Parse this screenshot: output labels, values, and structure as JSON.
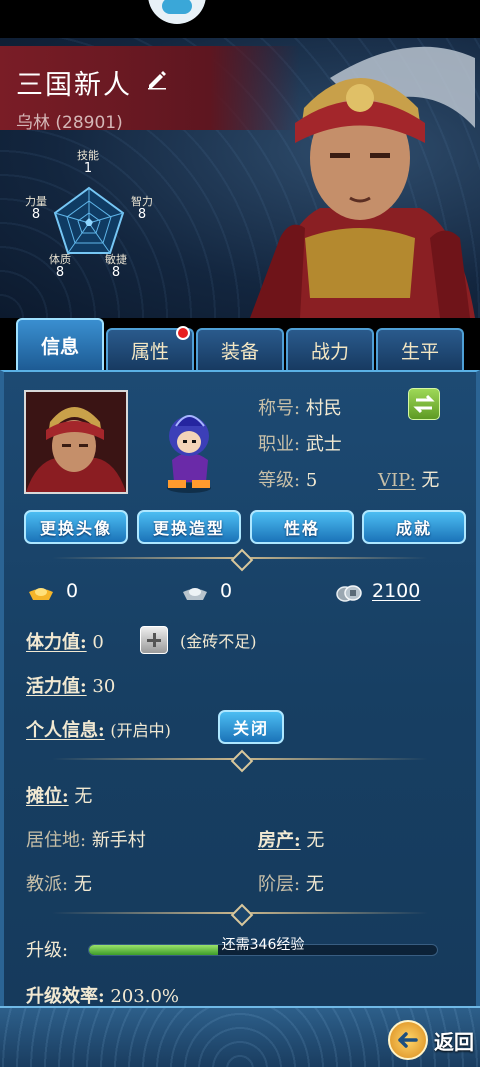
{
  "header": {
    "player_name": "三国新人",
    "player_id": "乌林 (28901)"
  },
  "radar": {
    "skill": {
      "label": "技能",
      "value": "1"
    },
    "wisdom": {
      "label": "智力",
      "value": "8"
    },
    "agility": {
      "label": "敏捷",
      "value": "8"
    },
    "constitution": {
      "label": "体质",
      "value": "8"
    },
    "strength": {
      "label": "力量",
      "value": "8"
    }
  },
  "tabs": [
    {
      "label": "信息",
      "active": true
    },
    {
      "label": "属性",
      "badge": true
    },
    {
      "label": "装备"
    },
    {
      "label": "战力"
    },
    {
      "label": "生平"
    }
  ],
  "profile": {
    "title_label": "称号:",
    "title_value": "村民",
    "job_label": "职业:",
    "job_value": "武士",
    "level_label": "等级:",
    "level_value": "5",
    "vip_label": "VIP:",
    "vip_value": "无"
  },
  "actions": {
    "change_avatar": "更换头像",
    "change_model": "更换造型",
    "personality": "性格",
    "achievements": "成就"
  },
  "resources": {
    "gold": "0",
    "silver": "0",
    "coins": "2100"
  },
  "stats": {
    "stamina_label": "体力值:",
    "stamina_value": "0",
    "stamina_note": "(金砖不足)",
    "vitality_label": "活力值:",
    "vitality_value": "30",
    "privacy_label": "个人信息:",
    "privacy_state": "(开启中)",
    "privacy_button": "关闭"
  },
  "details": {
    "stall_label": "摊位:",
    "stall_value": "无",
    "residence_label": "居住地:",
    "residence_value": "新手村",
    "property_label": "房产:",
    "property_value": "无",
    "sect_label": "教派:",
    "sect_value": "无",
    "rank_label": "阶层:",
    "rank_value": "无"
  },
  "upgrade": {
    "label": "升级:",
    "progress_text": "还需346经验",
    "progress": 0.37,
    "efficiency_label": "升级效率:",
    "efficiency_value": "203.0%"
  },
  "footer": {
    "back_label": "返回"
  },
  "icons": [
    "edit-icon",
    "swap-icon",
    "gold-ingot-icon",
    "silver-ingot-icon",
    "coin-stack-icon",
    "plus-icon",
    "back-arrow-icon"
  ]
}
